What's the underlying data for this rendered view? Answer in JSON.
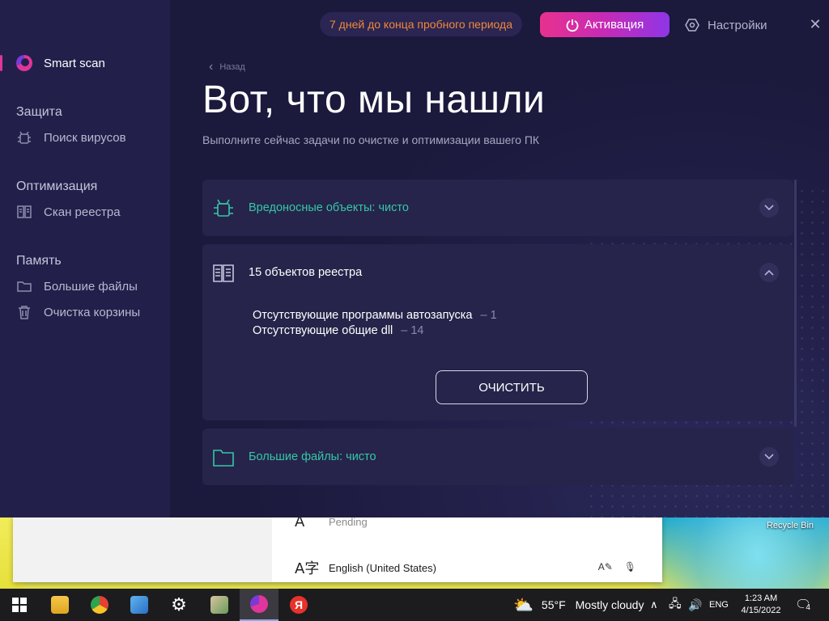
{
  "app": {
    "trial_text": "7 дней до конца пробного периода",
    "activate_label": "Активация",
    "settings_label": "Настройки",
    "close_glyph": "✕",
    "back_label": "Назад",
    "title": "Вот, что мы нашли",
    "subtitle": "Выполните сейчас задачи по очистке и оптимизации вашего ПК",
    "accent_color": "#e0359a",
    "clean_color": "#35c7a8"
  },
  "sidebar": {
    "main_item": "Smart scan",
    "sections": [
      {
        "title": "Защита",
        "items": [
          {
            "label": "Поиск вирусов",
            "icon": "bug-icon"
          }
        ]
      },
      {
        "title": "Оптимизация",
        "items": [
          {
            "label": "Скан реестра",
            "icon": "registry-icon"
          }
        ]
      },
      {
        "title": "Память",
        "items": [
          {
            "label": "Большие файлы",
            "icon": "folder-icon"
          },
          {
            "label": "Очистка корзины",
            "icon": "trash-icon"
          }
        ]
      }
    ]
  },
  "cards": {
    "malware": {
      "title": "Вредоносные объекты: чисто"
    },
    "registry": {
      "title": "15 объектов реестра",
      "lines": [
        {
          "label": "Отсутствующие программы автозапуска",
          "count": "– 1"
        },
        {
          "label": "Отсутствующие общие dll",
          "count": "– 14"
        }
      ],
      "clean_button": "ОЧИСТИТЬ"
    },
    "bigfiles": {
      "title": "Большие файлы: чисто"
    }
  },
  "language_popup": {
    "pending_label": "Pending",
    "language_label": "English (United States)"
  },
  "desktop": {
    "recycle_bin_label": "Recycle Bin"
  },
  "taskbar": {
    "temperature": "55°F",
    "weather": "Mostly cloudy",
    "lang": "ENG",
    "time": "1:23 AM",
    "date": "4/15/2022",
    "notifications": "4",
    "yandex_glyph": "Я"
  }
}
